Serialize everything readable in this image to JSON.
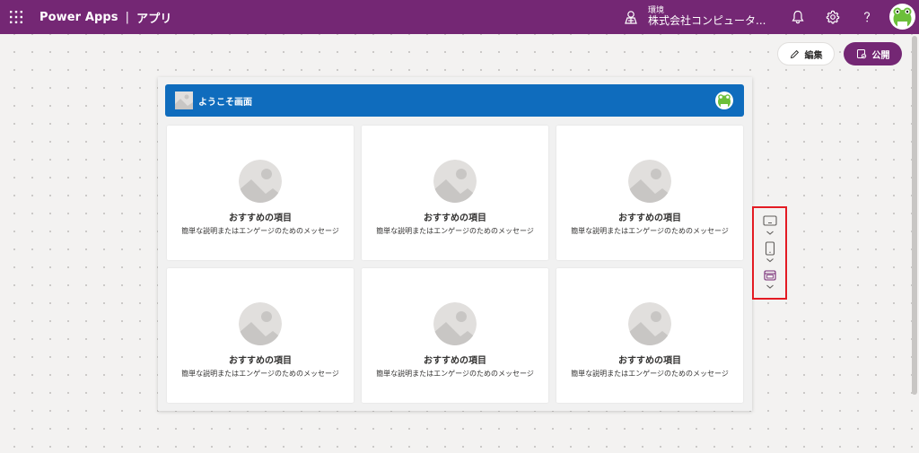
{
  "topbar": {
    "app_name": "Power Apps",
    "separator": "|",
    "section": "アプリ",
    "environment_label": "環境",
    "environment_name": "株式会社コンピュータ..."
  },
  "icons": {
    "waffle": "waffle-icon",
    "environment": "environment-icon",
    "notifications": "bell-icon",
    "settings": "gear-icon",
    "help": "help-icon",
    "edit": "pencil-icon",
    "publish": "publish-icon",
    "image_placeholder": "image-placeholder-icon"
  },
  "toolbar": {
    "edit_label": "編集",
    "publish_label": "公開"
  },
  "app": {
    "header_title": "ようこそ画面",
    "cards": [
      {
        "title": "おすすめの項目",
        "desc": "簡単な説明またはエンゲージのためのメッセージ"
      },
      {
        "title": "おすすめの項目",
        "desc": "簡単な説明またはエンゲージのためのメッセージ"
      },
      {
        "title": "おすすめの項目",
        "desc": "簡単な説明またはエンゲージのためのメッセージ"
      },
      {
        "title": "おすすめの項目",
        "desc": "簡単な説明またはエンゲージのためのメッセージ"
      },
      {
        "title": "おすすめの項目",
        "desc": "簡単な説明またはエンゲージのためのメッセージ"
      },
      {
        "title": "おすすめの項目",
        "desc": "簡単な説明またはエンゲージのためのメッセージ"
      }
    ]
  },
  "device_selector": [
    "tablet-icon",
    "phone-icon",
    "web-icon"
  ],
  "colors": {
    "brand": "#742774",
    "header_blue": "#0f6cbd",
    "highlight": "#e31b23"
  }
}
